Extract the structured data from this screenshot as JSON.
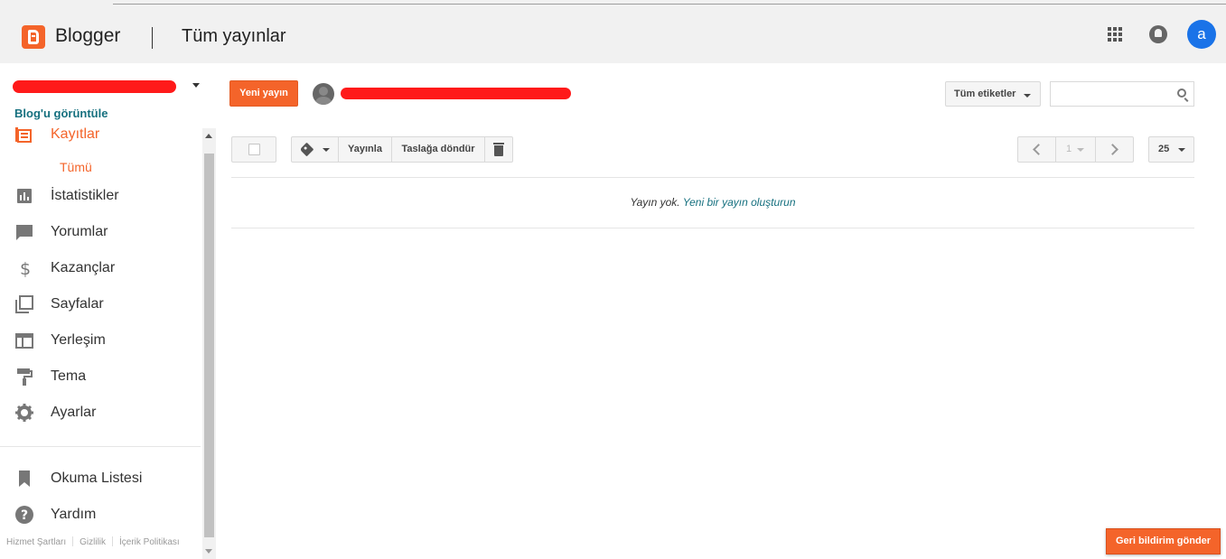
{
  "header": {
    "brand": "Blogger",
    "page_title": "Tüm yayınlar",
    "avatar_letter": "a"
  },
  "sidebar": {
    "view_blog": "Blog'u görüntüle",
    "items": [
      {
        "label": "Kayıtlar",
        "icon": "posts-icon",
        "active": true
      },
      {
        "label": "İstatistikler",
        "icon": "stats-icon"
      },
      {
        "label": "Yorumlar",
        "icon": "comments-icon"
      },
      {
        "label": "Kazançlar",
        "icon": "dollar-icon"
      },
      {
        "label": "Sayfalar",
        "icon": "pages-icon"
      },
      {
        "label": "Yerleşim",
        "icon": "layout-icon"
      },
      {
        "label": "Tema",
        "icon": "paint-roller-icon"
      },
      {
        "label": "Ayarlar",
        "icon": "gear-icon"
      }
    ],
    "sub_item": "Tümü",
    "bottom_items": [
      {
        "label": "Okuma Listesi",
        "icon": "bookmark-icon"
      },
      {
        "label": "Yardım",
        "icon": "help-icon"
      }
    ],
    "footer_links": [
      "Hizmet Şartları",
      "Gizlilik",
      "İçerik Politikası"
    ]
  },
  "toolbar": {
    "new_post": "Yeni yayın",
    "all_labels": "Tüm etiketler",
    "publish": "Yayınla",
    "revert_to_draft": "Taslağa döndür",
    "page_number": "1",
    "page_size": "25"
  },
  "list": {
    "empty_text": "Yayın yok.",
    "create_link": "Yeni bir yayın oluşturun"
  },
  "feedback_button": "Geri bildirim gönder",
  "colors": {
    "accent": "#f4642a",
    "link": "#16707f",
    "header_bg": "#f1f1f1",
    "avatar_bg": "#1a73e8"
  }
}
